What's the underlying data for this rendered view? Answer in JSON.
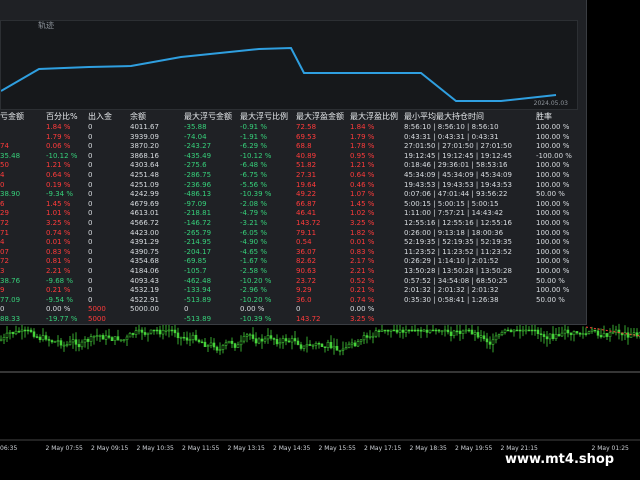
{
  "equity_title": "轨迹",
  "equity_date": "2024.05.03",
  "columns": [
    "亏金额",
    "百分比%",
    "出入金",
    "余额",
    "最大浮亏金额",
    "最大浮亏比例",
    "最大浮盈金额",
    "最大浮盈比例",
    "最小平均最大持仓时间",
    "胜率"
  ],
  "rows": [
    {
      "c0": "",
      "c1": "1.84 %",
      "c2": "0",
      "c3": "4011.67",
      "c4": "-35.88",
      "c5": "-0.91 %",
      "c6": "72.58",
      "c7": "1.84 %",
      "c8": "8:56:10 | 8:56:10 | 8:56:10",
      "c9": "100.00 %"
    },
    {
      "c0": "",
      "c1": "1.79 %",
      "c2": "0",
      "c3": "3939.09",
      "c4": "-74.04",
      "c5": "-1.91 %",
      "c6": "69.53",
      "c7": "1.79 %",
      "c8": "0:43:31 | 0:43:31 | 0:43:31",
      "c9": "100.00 %"
    },
    {
      "c0": "74",
      "c1": "0.06 %",
      "c2": "0",
      "c3": "3870.20",
      "c4": "-243.27",
      "c5": "-6.29 %",
      "c6": "68.8",
      "c7": "1.78 %",
      "c8": "27:01:50 | 27:01:50 | 27:01:50",
      "c9": "100.00 %"
    },
    {
      "c0": "35.48",
      "c1": "-10.12 %",
      "c2": "0",
      "c3": "3868.16",
      "c4": "-435.49",
      "c5": "-10.12 %",
      "c6": "40.89",
      "c7": "0.95 %",
      "c8": "19:12:45 | 19:12:45 | 19:12:45",
      "c9": "-100.00 %"
    },
    {
      "c0": "50",
      "c1": "1.21 %",
      "c2": "0",
      "c3": "4303.64",
      "c4": "-275.6",
      "c5": "-6.48 %",
      "c6": "51.82",
      "c7": "1.21 %",
      "c8": "0:18:46 | 29:36:01 | 58:53:16",
      "c9": "100.00 %"
    },
    {
      "c0": "4",
      "c1": "0.64 %",
      "c2": "0",
      "c3": "4251.48",
      "c4": "-286.75",
      "c5": "-6.75 %",
      "c6": "27.31",
      "c7": "0.64 %",
      "c8": "45:34:09 | 45:34:09 | 45:34:09",
      "c9": "100.00 %"
    },
    {
      "c0": "0",
      "c1": "0.19 %",
      "c2": "0",
      "c3": "4251.09",
      "c4": "-236.96",
      "c5": "-5.56 %",
      "c6": "19.64",
      "c7": "0.46 %",
      "c8": "19:43:53 | 19:43:53 | 19:43:53",
      "c9": "100.00 %"
    },
    {
      "c0": "38.90",
      "c1": "-9.34 %",
      "c2": "0",
      "c3": "4242.99",
      "c4": "-486.13",
      "c5": "-10.39 %",
      "c6": "49.22",
      "c7": "1.07 %",
      "c8": "0:07:06 | 47:01:44 | 93:56:22",
      "c9": "50.00 %"
    },
    {
      "c0": "6",
      "c1": "1.45 %",
      "c2": "0",
      "c3": "4679.69",
      "c4": "-97.09",
      "c5": "-2.08 %",
      "c6": "66.87",
      "c7": "1.45 %",
      "c8": "5:00:15 | 5:00:15 | 5:00:15",
      "c9": "100.00 %"
    },
    {
      "c0": "29",
      "c1": "1.01 %",
      "c2": "0",
      "c3": "4613.01",
      "c4": "-218.81",
      "c5": "-4.79 %",
      "c6": "46.41",
      "c7": "1.02 %",
      "c8": "1:11:00 | 7:57:21 | 14:43:42",
      "c9": "100.00 %"
    },
    {
      "c0": "72",
      "c1": "3.25 %",
      "c2": "0",
      "c3": "4566.72",
      "c4": "-146.72",
      "c5": "-3.21 %",
      "c6": "143.72",
      "c7": "3.25 %",
      "c8": "12:55:16 | 12:55:16 | 12:55:16",
      "c9": "100.00 %"
    },
    {
      "c0": "71",
      "c1": "0.74 %",
      "c2": "0",
      "c3": "4423.00",
      "c4": "-265.79",
      "c5": "-6.05 %",
      "c6": "79.11",
      "c7": "1.82 %",
      "c8": "0:26:00 | 9:13:18 | 18:00:36",
      "c9": "100.00 %"
    },
    {
      "c0": "4",
      "c1": "0.01 %",
      "c2": "0",
      "c3": "4391.29",
      "c4": "-214.95",
      "c5": "-4.90 %",
      "c6": "0.54",
      "c7": "0.01 %",
      "c8": "52:19:35 | 52:19:35 | 52:19:35",
      "c9": "100.00 %"
    },
    {
      "c0": "07",
      "c1": "0.83 %",
      "c2": "0",
      "c3": "4390.75",
      "c4": "-204.17",
      "c5": "-4.65 %",
      "c6": "36.07",
      "c7": "0.83 %",
      "c8": "11:23:52 | 11:23:52 | 11:23:52",
      "c9": "100.00 %"
    },
    {
      "c0": "72",
      "c1": "0.81 %",
      "c2": "0",
      "c3": "4354.68",
      "c4": "-69.85",
      "c5": "-1.67 %",
      "c6": "82.62",
      "c7": "2.17 %",
      "c8": "0:26:29 | 1:14:10 | 2:01:52",
      "c9": "100.00 %"
    },
    {
      "c0": "3",
      "c1": "2.21 %",
      "c2": "0",
      "c3": "4184.06",
      "c4": "-105.7",
      "c5": "-2.58 %",
      "c6": "90.63",
      "c7": "2.21 %",
      "c8": "13:50:28 | 13:50:28 | 13:50:28",
      "c9": "100.00 %"
    },
    {
      "c0": "38.76",
      "c1": "-9.68 %",
      "c2": "0",
      "c3": "4093.43",
      "c4": "-462.48",
      "c5": "-10.20 %",
      "c6": "23.72",
      "c7": "0.52 %",
      "c8": "0:57:52 | 34:54:08 | 68:50:25",
      "c9": "50.00 %"
    },
    {
      "c0": "9",
      "c1": "0.21 %",
      "c2": "0",
      "c3": "4532.19",
      "c4": "-133.94",
      "c5": "-2.96 %",
      "c6": "9.29",
      "c7": "0.21 %",
      "c8": "2:01:32 | 2:01:32 | 2:01:32",
      "c9": "100.00 %"
    },
    {
      "c0": "77.09",
      "c1": "-9.54 %",
      "c2": "0",
      "c3": "4522.91",
      "c4": "-513.89",
      "c5": "-10.20 %",
      "c6": "36.0",
      "c7": "0.74 %",
      "c8": "0:35:30 | 0:58:41 | 1:26:38",
      "c9": "50.00 %"
    },
    {
      "c0": "0",
      "c1": "0.00 %",
      "c2": "5000",
      "c3": "5000.00",
      "c4": "0",
      "c5": "0.00 %",
      "c6": "0",
      "c7": "0.00 %",
      "c8": "",
      "c9": ""
    },
    {
      "c0": "88.33",
      "c1": "-19.77 %",
      "c2": "5000",
      "c3": "",
      "c4": "-513.89",
      "c5": "-10.39 %",
      "c6": "143.72",
      "c7": "3.25 %",
      "c8": "",
      "c9": ""
    }
  ],
  "row_colors": [
    [
      "w",
      "r",
      "w",
      "w",
      "g",
      "g",
      "r",
      "r",
      "w",
      "w"
    ],
    [
      "w",
      "r",
      "w",
      "w",
      "g",
      "g",
      "r",
      "r",
      "w",
      "w"
    ],
    [
      "r",
      "r",
      "w",
      "w",
      "g",
      "g",
      "r",
      "r",
      "w",
      "w"
    ],
    [
      "g",
      "g",
      "w",
      "w",
      "g",
      "g",
      "r",
      "r",
      "w",
      "w"
    ],
    [
      "r",
      "r",
      "w",
      "w",
      "g",
      "g",
      "r",
      "r",
      "w",
      "w"
    ],
    [
      "r",
      "r",
      "w",
      "w",
      "g",
      "g",
      "r",
      "r",
      "w",
      "w"
    ],
    [
      "r",
      "r",
      "w",
      "w",
      "g",
      "g",
      "r",
      "r",
      "w",
      "w"
    ],
    [
      "g",
      "g",
      "w",
      "w",
      "g",
      "g",
      "r",
      "r",
      "w",
      "w"
    ],
    [
      "r",
      "r",
      "w",
      "w",
      "g",
      "g",
      "r",
      "r",
      "w",
      "w"
    ],
    [
      "r",
      "r",
      "w",
      "w",
      "g",
      "g",
      "r",
      "r",
      "w",
      "w"
    ],
    [
      "r",
      "r",
      "w",
      "w",
      "g",
      "g",
      "r",
      "r",
      "w",
      "w"
    ],
    [
      "r",
      "r",
      "w",
      "w",
      "g",
      "g",
      "r",
      "r",
      "w",
      "w"
    ],
    [
      "r",
      "r",
      "w",
      "w",
      "g",
      "g",
      "r",
      "r",
      "w",
      "w"
    ],
    [
      "r",
      "r",
      "w",
      "w",
      "g",
      "g",
      "r",
      "r",
      "w",
      "w"
    ],
    [
      "r",
      "r",
      "w",
      "w",
      "g",
      "g",
      "r",
      "r",
      "w",
      "w"
    ],
    [
      "r",
      "r",
      "w",
      "w",
      "g",
      "g",
      "r",
      "r",
      "w",
      "w"
    ],
    [
      "g",
      "g",
      "w",
      "w",
      "g",
      "g",
      "r",
      "r",
      "w",
      "w"
    ],
    [
      "r",
      "r",
      "w",
      "w",
      "g",
      "g",
      "r",
      "r",
      "w",
      "w"
    ],
    [
      "g",
      "g",
      "w",
      "w",
      "g",
      "g",
      "r",
      "r",
      "w",
      "w"
    ],
    [
      "w",
      "w",
      "r",
      "w",
      "w",
      "w",
      "w",
      "w",
      "w",
      "w"
    ],
    [
      "g",
      "g",
      "r",
      "w",
      "g",
      "g",
      "r",
      "r",
      "w",
      "w"
    ]
  ],
  "time_ticks": [
    "06:35",
    "2 May 07:55",
    "2 May 09:15",
    "2 May 10:35",
    "2 May 11:55",
    "2 May 13:15",
    "2 May 14:35",
    "2 May 15:55",
    "2 May 17:15",
    "2 May 18:35",
    "2 May 19:55",
    "2 May 21:15",
    "",
    "2 May 01:25"
  ],
  "watermark": "www.mt4.shop",
  "colors": {
    "panel_bg": "#1f2125",
    "equity_line": "#2f9fe0",
    "bull": "#46d23b",
    "bear": "#46d23b",
    "positive": "#36d07a",
    "negative": "#ff3b3b"
  }
}
